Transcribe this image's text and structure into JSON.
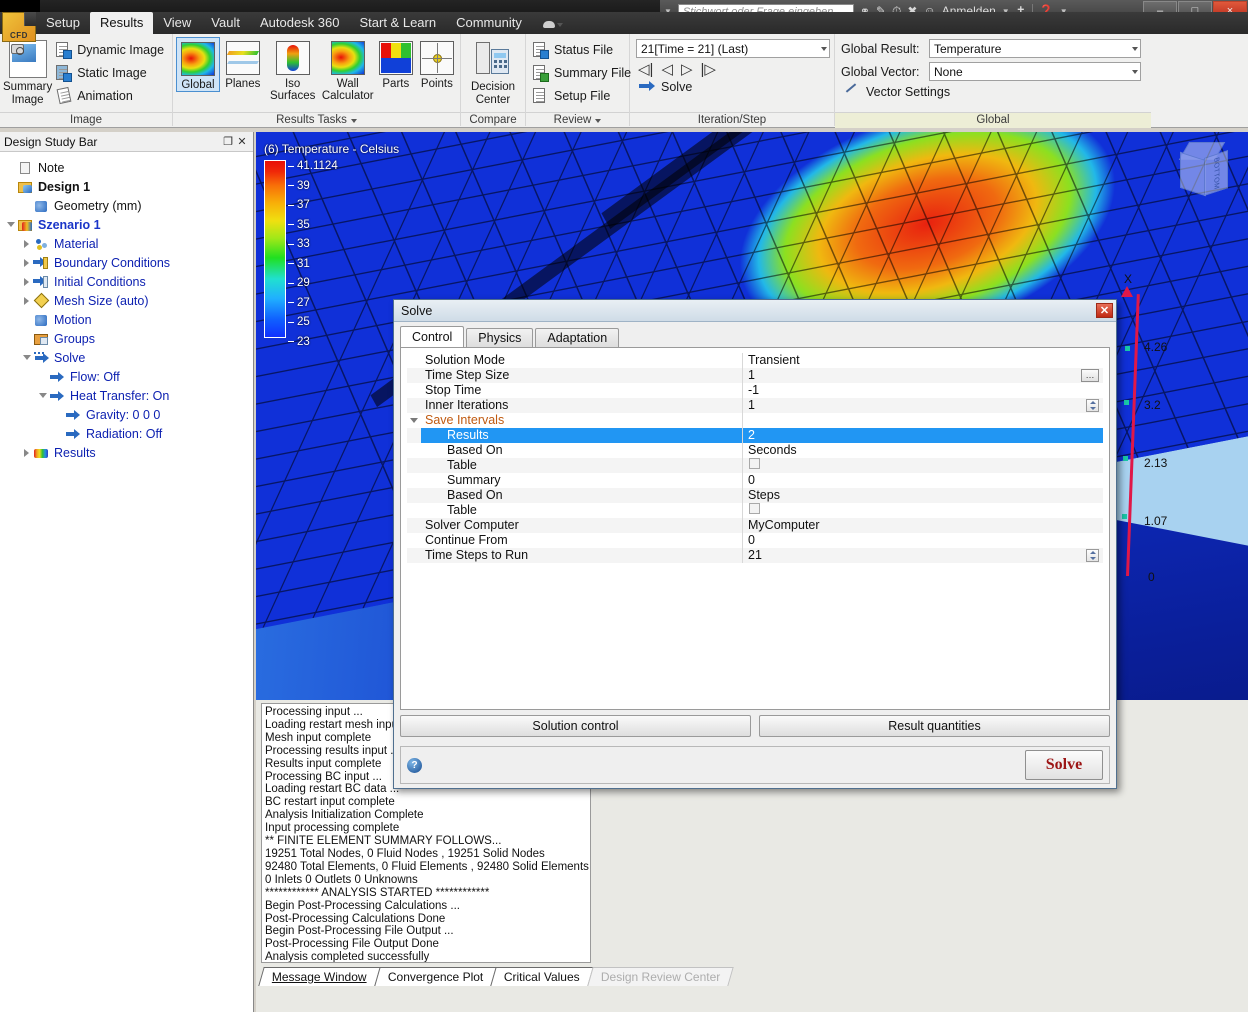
{
  "titlebar": {
    "search_placeholder": "Stichwort oder Frage eingeben",
    "signin_label": "Anmelden",
    "minimize": "–",
    "maximize": "□",
    "close": "×"
  },
  "ribbon": {
    "app_logo": "CFD",
    "tabs": [
      {
        "label": "Setup",
        "active": false
      },
      {
        "label": "Results",
        "active": true
      },
      {
        "label": "View",
        "active": false
      },
      {
        "label": "Vault",
        "active": false
      },
      {
        "label": "Autodesk 360",
        "active": false
      },
      {
        "label": "Start & Learn",
        "active": false
      },
      {
        "label": "Community",
        "active": false
      }
    ],
    "panels": {
      "image": {
        "title": "Image",
        "big_button": {
          "line1": "Summary",
          "line2": "Image"
        },
        "items": [
          {
            "label": "Dynamic Image"
          },
          {
            "label": "Static Image"
          },
          {
            "label": "Animation"
          }
        ]
      },
      "results_tasks": {
        "title": "Results Tasks",
        "items": [
          {
            "label": "Global",
            "selected": true
          },
          {
            "label": "Planes",
            "selected": false
          },
          {
            "label": "Iso Surfaces",
            "selected": false
          },
          {
            "label1": "Wall",
            "label2": "Calculator",
            "selected": false
          },
          {
            "label": "Parts",
            "selected": false
          },
          {
            "label": "Points",
            "selected": false
          }
        ]
      },
      "compare": {
        "title": "Compare",
        "button": {
          "line1": "Decision",
          "line2": "Center"
        }
      },
      "review": {
        "title": "Review",
        "items": [
          {
            "label": "Status File"
          },
          {
            "label": "Summary File"
          },
          {
            "label": "Setup File"
          }
        ]
      },
      "iteration_step": {
        "title": "Iteration/Step",
        "step_value": "21[Time = 21] (Last)",
        "nav": [
          "first-step",
          "previous-step",
          "next-step",
          "last-step"
        ],
        "solve_label": "Solve"
      },
      "global": {
        "title": "Global",
        "result_label": "Global Result:",
        "result_value": "Temperature",
        "vector_label": "Global Vector:",
        "vector_value": "None",
        "vector_settings_label": "Vector Settings"
      }
    }
  },
  "design_study_bar": {
    "title": "Design Study Bar",
    "tree": [
      {
        "label": "Note",
        "depth": 0,
        "icon": "note-icon",
        "expander": "none",
        "style": "black"
      },
      {
        "label": "Design 1",
        "depth": 0,
        "icon": "design-icon",
        "expander": "none",
        "style": "bold"
      },
      {
        "label": "Geometry (mm)",
        "depth": 1,
        "icon": "geometry-icon",
        "expander": "none",
        "style": "black"
      },
      {
        "label": "Szenario 1",
        "depth": 0,
        "icon": "scenario-icon",
        "expander": "open",
        "style": "boldblue"
      },
      {
        "label": "Material",
        "depth": 1,
        "icon": "material-icon",
        "expander": "closed",
        "style": "link"
      },
      {
        "label": "Boundary Conditions",
        "depth": 1,
        "icon": "boundary-icon",
        "expander": "closed",
        "style": "link"
      },
      {
        "label": "Initial Conditions",
        "depth": 1,
        "icon": "initial-icon",
        "expander": "closed",
        "style": "link"
      },
      {
        "label": "Mesh Size (auto)",
        "depth": 1,
        "icon": "mesh-icon",
        "expander": "closed",
        "style": "link"
      },
      {
        "label": "Motion",
        "depth": 1,
        "icon": "motion-icon",
        "expander": "none",
        "style": "link"
      },
      {
        "label": "Groups",
        "depth": 1,
        "icon": "groups-icon",
        "expander": "none",
        "style": "link"
      },
      {
        "label": "Solve",
        "depth": 1,
        "icon": "solve-icon",
        "expander": "open",
        "style": "link"
      },
      {
        "label": "Flow: Off",
        "depth": 2,
        "icon": "flow-icon",
        "expander": "none",
        "style": "link"
      },
      {
        "label": "Heat Transfer: On",
        "depth": 2,
        "icon": "heat-icon",
        "expander": "open",
        "style": "link"
      },
      {
        "label": "Gravity: 0 0 0",
        "depth": 3,
        "icon": "gravity-icon",
        "expander": "none",
        "style": "link"
      },
      {
        "label": "Radiation: Off",
        "depth": 3,
        "icon": "radiation-icon",
        "expander": "none",
        "style": "link"
      },
      {
        "label": "Results",
        "depth": 1,
        "icon": "results-icon",
        "expander": "closed",
        "style": "link"
      }
    ]
  },
  "viewport": {
    "legend": {
      "title": "(6) Temperature - Celsius",
      "max_label": "41.1124",
      "ticks": [
        "41.1124",
        "39",
        "37",
        "35",
        "33",
        "31",
        "29",
        "27",
        "25",
        "23"
      ],
      "unit": "Celsius",
      "quantity": "Temperature",
      "result_index": "(6)"
    },
    "axis": {
      "name": "X",
      "ticks": [
        "4.26",
        "3.2",
        "2.13",
        "1.07",
        "0"
      ]
    },
    "viewcube_label": "BOTTOM"
  },
  "solve_dialog": {
    "title": "Solve",
    "close_label": "✕",
    "tabs": [
      {
        "label": "Control",
        "active": true
      },
      {
        "label": "Physics",
        "active": false
      },
      {
        "label": "Adaptation",
        "active": false
      }
    ],
    "rows": [
      {
        "name": "Solution Mode",
        "value": "Transient",
        "indent": 0,
        "widget": "none",
        "selected": false,
        "group": false,
        "expander": "none"
      },
      {
        "name": "Time Step Size",
        "value": "1",
        "indent": 0,
        "widget": "browse",
        "selected": false,
        "group": false,
        "expander": "none"
      },
      {
        "name": "Stop Time",
        "value": "-1",
        "indent": 0,
        "widget": "none",
        "selected": false,
        "group": false,
        "expander": "none"
      },
      {
        "name": "Inner Iterations",
        "value": "1",
        "indent": 0,
        "widget": "spinner",
        "selected": false,
        "group": false,
        "expander": "none"
      },
      {
        "name": "Save Intervals",
        "value": "",
        "indent": 0,
        "widget": "none",
        "selected": false,
        "group": true,
        "expander": "open"
      },
      {
        "name": "Results",
        "value": "2",
        "indent": 1,
        "widget": "none",
        "selected": true,
        "group": false,
        "expander": "none"
      },
      {
        "name": "Based On",
        "value": "Seconds",
        "indent": 1,
        "widget": "none",
        "selected": false,
        "group": false,
        "expander": "none"
      },
      {
        "name": "Table",
        "value": "",
        "indent": 1,
        "widget": "checkbox",
        "selected": false,
        "group": false,
        "expander": "none"
      },
      {
        "name": "Summary",
        "value": "0",
        "indent": 1,
        "widget": "none",
        "selected": false,
        "group": false,
        "expander": "none"
      },
      {
        "name": "Based On",
        "value": "Steps",
        "indent": 1,
        "widget": "none",
        "selected": false,
        "group": false,
        "expander": "none"
      },
      {
        "name": "Table",
        "value": "",
        "indent": 1,
        "widget": "checkbox",
        "selected": false,
        "group": false,
        "expander": "none"
      },
      {
        "name": "Solver Computer",
        "value": "MyComputer",
        "indent": 0,
        "widget": "none",
        "selected": false,
        "group": false,
        "expander": "none"
      },
      {
        "name": "Continue From",
        "value": "0",
        "indent": 0,
        "widget": "none",
        "selected": false,
        "group": false,
        "expander": "none"
      },
      {
        "name": "Time Steps to Run",
        "value": "21",
        "indent": 0,
        "widget": "spinner",
        "selected": false,
        "group": false,
        "expander": "none"
      }
    ],
    "solution_control_label": "Solution control",
    "result_quantities_label": "Result quantities",
    "help_label": "?",
    "solve_label": "Solve"
  },
  "message_window": {
    "lines": [
      "Processing input ...",
      "Loading restart mesh input ...",
      "Mesh input complete",
      "Processing results input ...",
      "Results input complete",
      "Processing BC input ...",
      "Loading restart BC data ...",
      "BC restart input complete",
      "Analysis Initialization Complete",
      "Input processing complete",
      "** FINITE ELEMENT SUMMARY FOLLOWS...",
      "19251 Total Nodes,  0 Fluid Nodes ,   19251 Solid Nodes",
      "92480 Total Elements,  0 Fluid Elements ,   92480 Solid Elements",
      "0 Inlets   0 Outlets   0 Unknowns",
      "************ ANALYSIS STARTED ************",
      "Begin Post-Processing Calculations ...",
      "Post-Processing Calculations Done",
      "Begin Post-Processing File Output ...",
      "Post-Processing File Output Done",
      "Analysis completed successfully"
    ],
    "tabs": [
      {
        "label": "Message Window",
        "active": true,
        "disabled": false
      },
      {
        "label": "Convergence Plot",
        "active": false,
        "disabled": false
      },
      {
        "label": "Critical Values",
        "active": false,
        "disabled": false
      },
      {
        "label": "Design Review Center",
        "active": false,
        "disabled": true
      }
    ]
  },
  "colors": {
    "accent": "#2196f3",
    "solve_red": "#9c1414",
    "tree_link": "#0b1fb0",
    "group_orange": "#c05a10"
  }
}
